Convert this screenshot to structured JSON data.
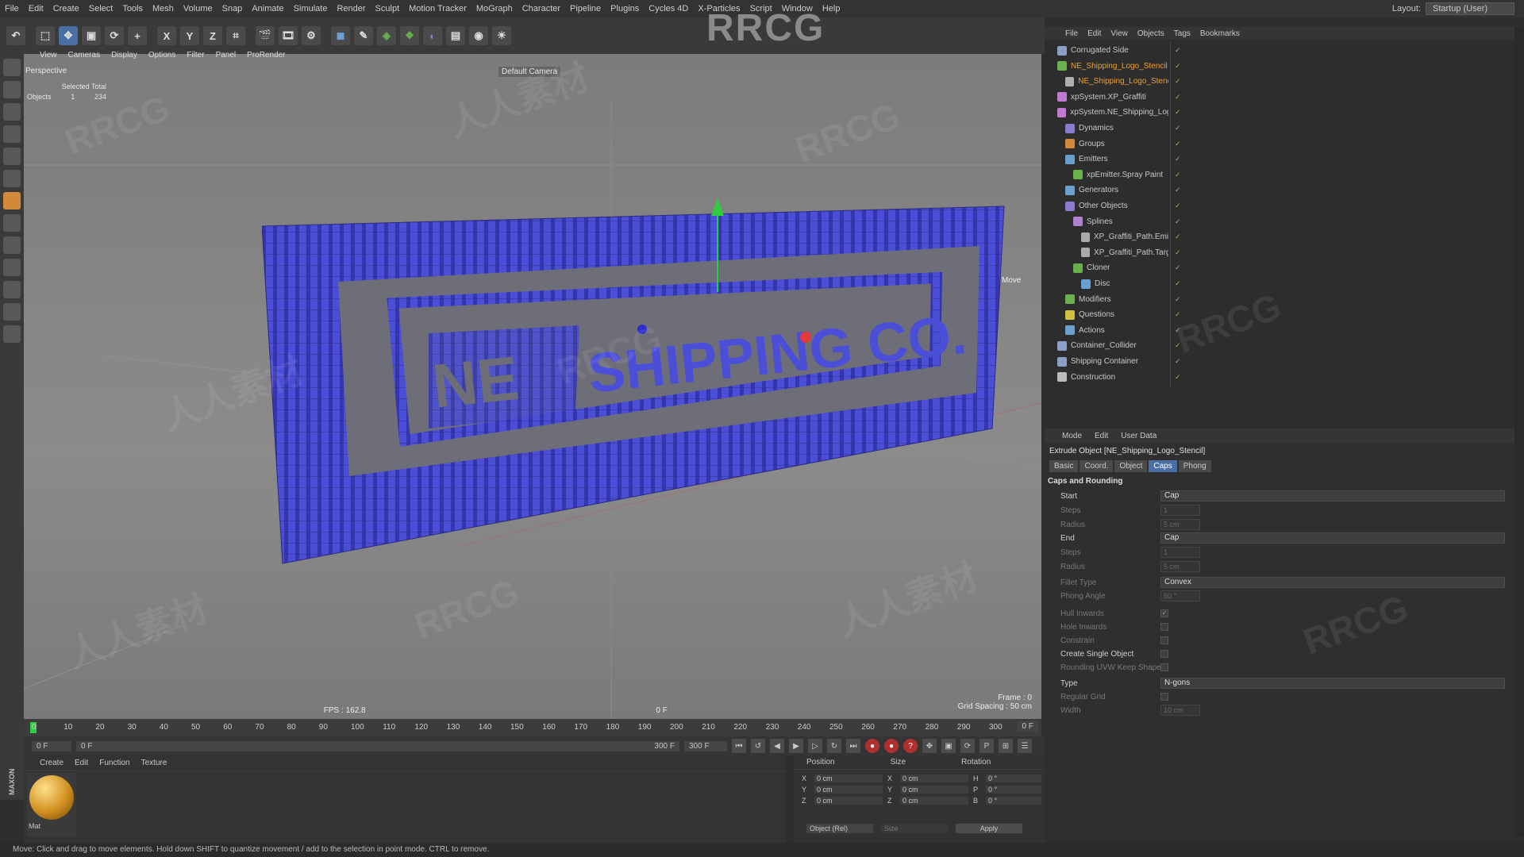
{
  "menu": [
    "File",
    "Edit",
    "Create",
    "Select",
    "Tools",
    "Mesh",
    "Volume",
    "Snap",
    "Animate",
    "Simulate",
    "Render",
    "Sculpt",
    "Motion Tracker",
    "MoGraph",
    "Character",
    "Pipeline",
    "Plugins",
    "Cycles 4D",
    "X-Particles",
    "Script",
    "Window",
    "Help"
  ],
  "layout_label": "Layout:",
  "layout_value": "Startup (User)",
  "brand": "RRCG",
  "toolbar_axes": [
    "X",
    "Y",
    "Z"
  ],
  "viewport": {
    "menu": [
      "View",
      "Cameras",
      "Display",
      "Options",
      "Filter",
      "Panel",
      "ProRender"
    ],
    "name": "Perspective",
    "camera": "Default Camera",
    "stats_header": "Selected Total",
    "stats_label": "Objects",
    "stats_selected": "1",
    "stats_total": "234",
    "move_label": "Move",
    "fps": "FPS : 162.8",
    "frame_mid": "0 F",
    "frame": "Frame : 0",
    "grid": "Grid Spacing : 50 cm",
    "sign_text_1": "NE",
    "sign_text_2": "SHIPPING CO."
  },
  "timeline": {
    "ticks": [
      "0",
      "10",
      "20",
      "30",
      "40",
      "50",
      "60",
      "70",
      "80",
      "90",
      "100",
      "110",
      "120",
      "130",
      "140",
      "150",
      "160",
      "170",
      "180",
      "190",
      "200",
      "210",
      "220",
      "230",
      "240",
      "250",
      "260",
      "270",
      "280",
      "290",
      "300"
    ],
    "end_field": "0 F",
    "start": "0 F",
    "min": "0 F",
    "max": "300 F",
    "max2": "300 F"
  },
  "material": {
    "menu": [
      "Create",
      "Edit",
      "Function",
      "Texture"
    ],
    "name": "Mat"
  },
  "coords": {
    "headers": [
      "Position",
      "Size",
      "Rotation"
    ],
    "rows": [
      {
        "axis": "X",
        "pos": "0 cm",
        "size": "0 cm",
        "rlabel": "H",
        "rot": "0 °"
      },
      {
        "axis": "Y",
        "pos": "0 cm",
        "size": "0 cm",
        "rlabel": "P",
        "rot": "0 °"
      },
      {
        "axis": "Z",
        "pos": "0 cm",
        "size": "0 cm",
        "rlabel": "B",
        "rot": "0 °"
      }
    ],
    "mode": "Object (Rel)",
    "size_mode": "Size",
    "apply": "Apply"
  },
  "status": "Move: Click and drag to move elements. Hold down SHIFT to quantize movement / add to the selection in point mode. CTRL to remove.",
  "object_manager": {
    "menu": [
      "File",
      "Edit",
      "View",
      "Objects",
      "Tags",
      "Bookmarks"
    ],
    "items": [
      {
        "name": "Corrugated Side",
        "indent": 0,
        "color": "#8aa0c8",
        "highlight": false
      },
      {
        "name": "NE_Shipping_Logo_Stencil",
        "indent": 0,
        "color": "#6ab04c",
        "highlight": true
      },
      {
        "name": "NE_Shipping_Logo_Stencil",
        "indent": 1,
        "color": "#b0b0b0",
        "highlight": true
      },
      {
        "name": "xpSystem.XP_Graffiti",
        "indent": 0,
        "color": "#c07ad0",
        "highlight": false
      },
      {
        "name": "xpSystem.NE_Shipping_Logo",
        "indent": 0,
        "color": "#c07ad0",
        "highlight": false
      },
      {
        "name": "Dynamics",
        "indent": 1,
        "color": "#8c7ad0",
        "highlight": false
      },
      {
        "name": "Groups",
        "indent": 1,
        "color": "#d08a3a",
        "highlight": false
      },
      {
        "name": "Emitters",
        "indent": 1,
        "color": "#6aa0d0",
        "highlight": false
      },
      {
        "name": "xpEmitter.Spray Paint",
        "indent": 2,
        "color": "#6ab04c",
        "highlight": false
      },
      {
        "name": "Generators",
        "indent": 1,
        "color": "#6aa0d0",
        "highlight": false
      },
      {
        "name": "Other Objects",
        "indent": 1,
        "color": "#8c7ad0",
        "highlight": false
      },
      {
        "name": "Splines",
        "indent": 2,
        "color": "#b080d0",
        "highlight": false
      },
      {
        "name": "XP_Graffiti_Path.Emiss",
        "indent": 3,
        "color": "#aaaaaa",
        "highlight": false
      },
      {
        "name": "XP_Graffiti_Path.Targe",
        "indent": 3,
        "color": "#aaaaaa",
        "highlight": false
      },
      {
        "name": "Cloner",
        "indent": 2,
        "color": "#6ab04c",
        "highlight": false
      },
      {
        "name": "Disc",
        "indent": 3,
        "color": "#6aa0d0",
        "highlight": false
      },
      {
        "name": "Modifiers",
        "indent": 1,
        "color": "#6ab04c",
        "highlight": false
      },
      {
        "name": "Questions",
        "indent": 1,
        "color": "#d0c040",
        "highlight": false
      },
      {
        "name": "Actions",
        "indent": 1,
        "color": "#6aa0d0",
        "highlight": false
      },
      {
        "name": "Container_Collider",
        "indent": 0,
        "color": "#8aa0c8",
        "highlight": false
      },
      {
        "name": "Shipping Container",
        "indent": 0,
        "color": "#8aa0c8",
        "highlight": false
      },
      {
        "name": "Construction",
        "indent": 0,
        "color": "#bbbbbb",
        "highlight": false
      }
    ]
  },
  "attributes": {
    "menu": [
      "Mode",
      "Edit",
      "User Data"
    ],
    "title": "Extrude Object [NE_Shipping_Logo_Stencil]",
    "tabs": [
      "Basic",
      "Coord.",
      "Object",
      "Caps",
      "Phong"
    ],
    "active_tab": "Caps",
    "section": "Caps and Rounding",
    "rows": [
      {
        "label": "Start",
        "kind": "dropdown",
        "value": "Cap",
        "dim": false
      },
      {
        "label": "Steps",
        "kind": "field",
        "value": "1",
        "dim": true
      },
      {
        "label": "Radius",
        "kind": "field",
        "value": "5 cm",
        "dim": true
      },
      {
        "label": "End",
        "kind": "dropdown",
        "value": "Cap",
        "dim": false
      },
      {
        "label": "Steps",
        "kind": "field",
        "value": "1",
        "dim": true
      },
      {
        "label": "Radius",
        "kind": "field",
        "value": "5 cm",
        "dim": true
      },
      {
        "label": "Fillet Type",
        "kind": "dropdown",
        "value": "Convex",
        "dim": true
      },
      {
        "label": "Phong Angle",
        "kind": "field",
        "value": "60 °",
        "dim": true
      },
      {
        "label": "Hull Inwards",
        "kind": "check",
        "value": "✓",
        "dim": true
      },
      {
        "label": "Hole Inwards",
        "kind": "check",
        "value": "",
        "dim": true
      },
      {
        "label": "Constrain",
        "kind": "check",
        "value": "",
        "dim": true
      },
      {
        "label": "Create Single Object",
        "kind": "check",
        "value": "",
        "dim": false
      },
      {
        "label": "Rounding UVW Keep Shape",
        "kind": "check",
        "value": "",
        "dim": true
      },
      {
        "label": "Type",
        "kind": "dropdown",
        "value": "N-gons",
        "dim": false
      },
      {
        "label": "Regular Grid",
        "kind": "check",
        "value": "",
        "dim": true
      },
      {
        "label": "Width",
        "kind": "field",
        "value": "10 cm",
        "dim": true
      }
    ]
  },
  "watermarks": [
    "RRCG",
    "人人素材",
    "RRCG",
    "人人素材",
    "RRCG",
    "RRCG",
    "人人素材",
    "RRCG",
    "人人素材",
    "RRCG"
  ],
  "colors": {
    "accent": "#4a6fa5",
    "mesh": "#4b4fd8",
    "panel": "#2d2d2d",
    "highlight": "#f0a030"
  }
}
